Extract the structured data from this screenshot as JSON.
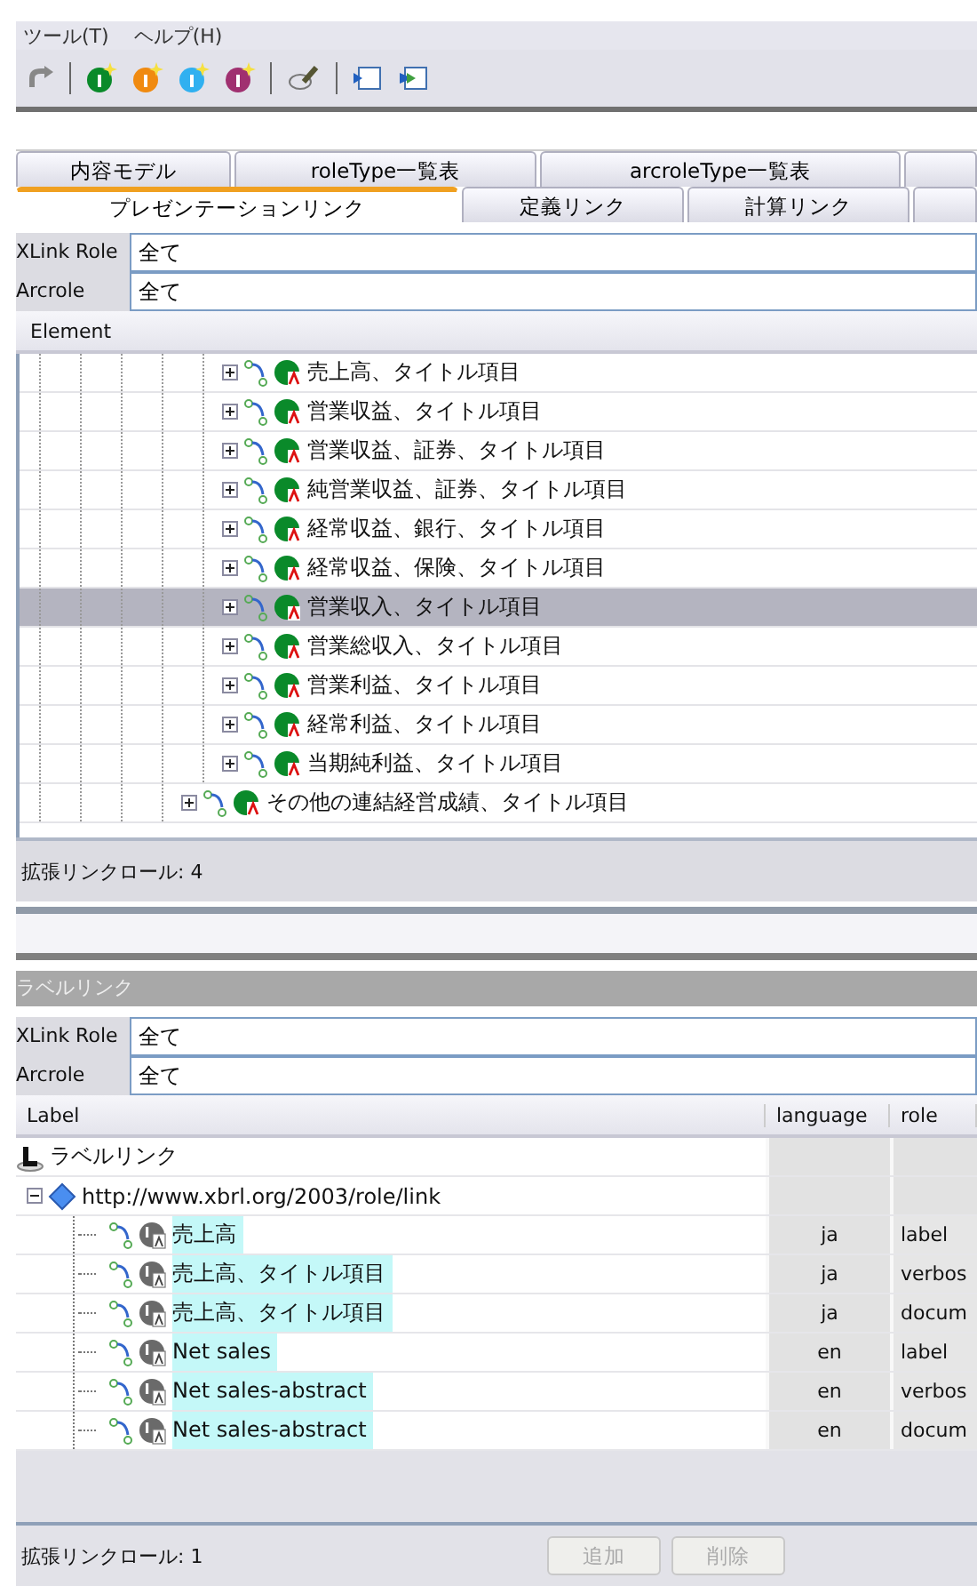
{
  "menu": [
    "ツール(T)",
    "ヘルプ(H)"
  ],
  "tab_rows": [
    [
      {
        "label": "内容モデル",
        "selected": false
      },
      {
        "label": "roleType一覧表",
        "selected": false
      },
      {
        "label": "arcroleType一覧表",
        "selected": false
      }
    ],
    [
      {
        "label": "プレゼンテーションリンク",
        "selected": true
      },
      {
        "label": "定義リンク",
        "selected": false
      },
      {
        "label": "計算リンク",
        "selected": false
      }
    ]
  ],
  "presentation": {
    "filters": [
      {
        "label": "XLink Role",
        "value": "全て"
      },
      {
        "label": "Arcrole",
        "value": "全て"
      }
    ],
    "column": "Element",
    "tree": [
      {
        "children": [
          {
            "label": "売上高、タイトル項目",
            "expanded": false,
            "selected": false
          },
          {
            "label": "営業収益、タイトル項目",
            "expanded": false,
            "selected": false
          },
          {
            "label": "営業収益、証券、タイトル項目",
            "expanded": false,
            "selected": false
          },
          {
            "label": "純営業収益、証券、タイトル項目",
            "expanded": false,
            "selected": false
          },
          {
            "label": "経常収益、銀行、タイトル項目",
            "expanded": false,
            "selected": false
          },
          {
            "label": "経常収益、保険、タイトル項目",
            "expanded": false,
            "selected": false
          },
          {
            "label": "営業収入、タイトル項目",
            "expanded": false,
            "selected": true
          },
          {
            "label": "営業総収入、タイトル項目",
            "expanded": false,
            "selected": false
          },
          {
            "label": "営業利益、タイトル項目",
            "expanded": false,
            "selected": false
          },
          {
            "label": "経常利益、タイトル項目",
            "expanded": false,
            "selected": false
          },
          {
            "label": "当期純利益、タイトル項目",
            "expanded": false,
            "selected": false
          }
        ]
      },
      {
        "label": "その他の連結経営成績、タイトル項目",
        "expanded": false,
        "selected": false
      }
    ],
    "status": "拡張リンクロール: 4"
  },
  "label_panel": {
    "title": "ラベルリンク",
    "filters": [
      {
        "label": "XLink Role",
        "value": "全て"
      },
      {
        "label": "Arcrole",
        "value": "全て"
      }
    ],
    "columns": [
      "Label",
      "language",
      "role"
    ],
    "tree": [
      {
        "kind": "root",
        "label": "ラベルリンク",
        "children": [
          {
            "kind": "role",
            "label": "http://www.xbrl.org/2003/role/link",
            "expanded": true,
            "children": [
              {
                "kind": "label",
                "label": "売上高",
                "language": "ja",
                "role": "label"
              },
              {
                "kind": "label",
                "label": "売上高、タイトル項目",
                "language": "ja",
                "role": "verbos"
              },
              {
                "kind": "label",
                "label": "売上高、タイトル項目",
                "language": "ja",
                "role": "docum"
              },
              {
                "kind": "label",
                "label": "Net sales",
                "language": "en",
                "role": "label"
              },
              {
                "kind": "label",
                "label": "Net sales-abstract",
                "language": "en",
                "role": "verbos"
              },
              {
                "kind": "label",
                "label": "Net sales-abstract",
                "language": "en",
                "role": "docum"
              }
            ]
          }
        ]
      }
    ],
    "status": "拡張リンクロール: 1",
    "buttons": [
      {
        "label": "追加",
        "disabled": true
      },
      {
        "label": "削除",
        "disabled": true
      }
    ]
  }
}
